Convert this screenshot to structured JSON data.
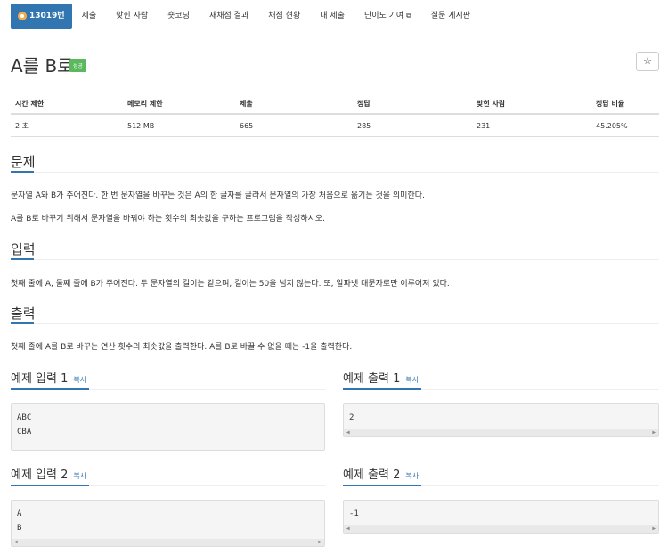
{
  "nav": {
    "active_tab": "13019번",
    "tabs": [
      "제출",
      "맞힌 사람",
      "숏코딩",
      "재채점 결과",
      "채점 현황",
      "내 제출",
      "난이도 기여",
      "질문 게시판"
    ]
  },
  "problem": {
    "title": "A를 B로",
    "status_badge": "성공",
    "star": "☆"
  },
  "info_table": {
    "headers": [
      "시간 제한",
      "메모리 제한",
      "제출",
      "정답",
      "맞힌 사람",
      "정답 비율"
    ],
    "values": [
      "2 초",
      "512 MB",
      "665",
      "285",
      "231",
      "45.205%"
    ]
  },
  "sections": {
    "problem_head": "문제",
    "problem_p1": "문자열 A와 B가 주어진다. 한 번 문자열을 바꾸는 것은 A의 한 글자를 골라서 문자열의 가장 처음으로 옮기는 것을 의미한다.",
    "problem_p2": "A를 B로 바꾸기 위해서 문자열을 바꿔야 하는 횟수의 최솟값을 구하는 프로그램을 작성하시오.",
    "input_head": "입력",
    "input_p": "첫째 줄에 A, 둘째 줄에 B가 주어진다. 두 문자열의 길이는 같으며, 길이는 50을 넘지 않는다. 또, 알파벳 대문자로만 이루어져 있다.",
    "output_head": "출력",
    "output_p": "첫째 줄에 A를 B로 바꾸는 연산 횟수의 최솟값을 출력한다. A를 B로 바꿀 수 없을 때는 -1을 출력한다."
  },
  "samples": {
    "copy_label": "복사",
    "in1_head": "예제 입력 1",
    "in1": [
      "ABC",
      "CBA"
    ],
    "out1_head": "예제 출력 1",
    "out1": [
      "2"
    ],
    "in2_head": "예제 입력 2",
    "in2": [
      "A",
      "B"
    ],
    "out2_head": "예제 출력 2",
    "out2": [
      "-1"
    ]
  },
  "colors": {
    "primary": "#3276b1",
    "success": "#5cb85c"
  }
}
